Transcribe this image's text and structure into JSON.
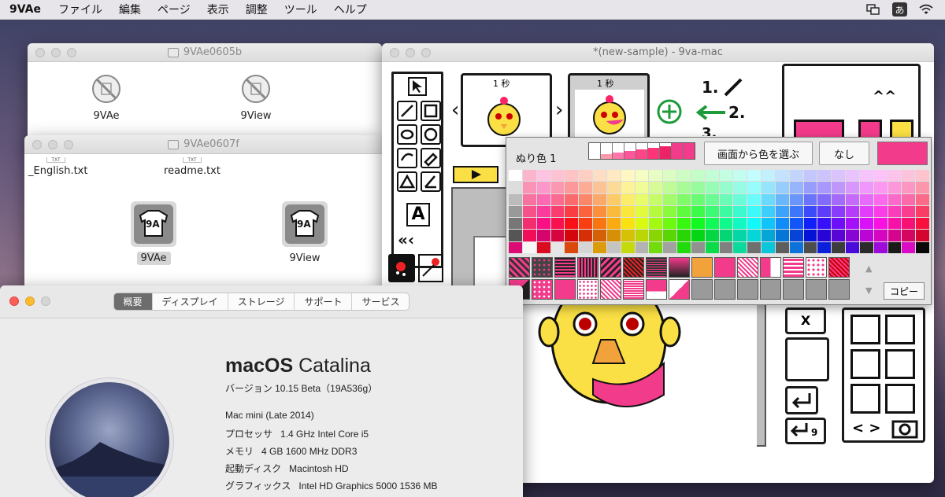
{
  "menubar": {
    "app_name": "9VAe",
    "items": [
      "ファイル",
      "編集",
      "ページ",
      "表示",
      "調整",
      "ツール",
      "ヘルプ"
    ],
    "ime_label": "あ"
  },
  "finder1": {
    "title": "9VAe0605b",
    "icons": [
      {
        "label": "9VAe"
      },
      {
        "label": "9View"
      }
    ]
  },
  "finder2": {
    "title": "9VAe0607f",
    "files": [
      {
        "label": "_English.txt",
        "type_badge": "TXT"
      },
      {
        "label": "readme.txt",
        "type_badge": "TXT"
      }
    ],
    "apps": [
      {
        "label": "9VAe",
        "glyph": "9A"
      },
      {
        "label": "9View",
        "glyph": "9A"
      }
    ]
  },
  "main_window": {
    "title": "*(new-sample)  - 9va-mac",
    "frames": [
      {
        "label": "1 秒"
      },
      {
        "label": "1 秒"
      }
    ],
    "steps": [
      "1.",
      "2.",
      "3."
    ],
    "tool_text": "A",
    "x_button": "X",
    "nav_arrows": "< >"
  },
  "palette": {
    "label": "ぬり色 1",
    "pick_button": "画面から色を選ぶ",
    "none_button": "なし",
    "copy_button": "コピー",
    "current_color": "#f33b8b"
  },
  "about": {
    "tabs": [
      {
        "label": "概要",
        "active": true
      },
      {
        "label": "ディスプレイ"
      },
      {
        "label": "ストレージ"
      },
      {
        "label": "サポート"
      },
      {
        "label": "サービス"
      }
    ],
    "os_name": "macOS",
    "os_version_name": "Catalina",
    "version_text": "バージョン 10.15 Beta（19A536g）",
    "model": "Mac mini (Late 2014)",
    "specs": [
      {
        "key": "プロセッサ",
        "value": "1.4 GHz Intel Core i5"
      },
      {
        "key": "メモリ",
        "value": "4 GB 1600 MHz DDR3"
      },
      {
        "key": "起動ディスク",
        "value": "Macintosh HD"
      },
      {
        "key": "グラフィックス",
        "value": "Intel HD Graphics 5000 1536 MB"
      }
    ]
  }
}
